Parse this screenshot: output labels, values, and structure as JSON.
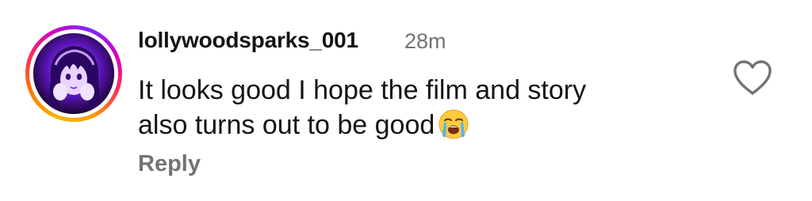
{
  "comment": {
    "username": "lollywoodsparks_001",
    "timestamp": "28m",
    "text_lines": [
      "It looks good I hope the film and story",
      "also turns out to be good"
    ],
    "emoji": "loudly-crying-face",
    "reply_label": "Reply",
    "like_icon": "heart-outline-icon",
    "story_ring_colors": [
      "#f7b500",
      "#ff2d55",
      "#d300c5",
      "#7b2bff"
    ]
  }
}
